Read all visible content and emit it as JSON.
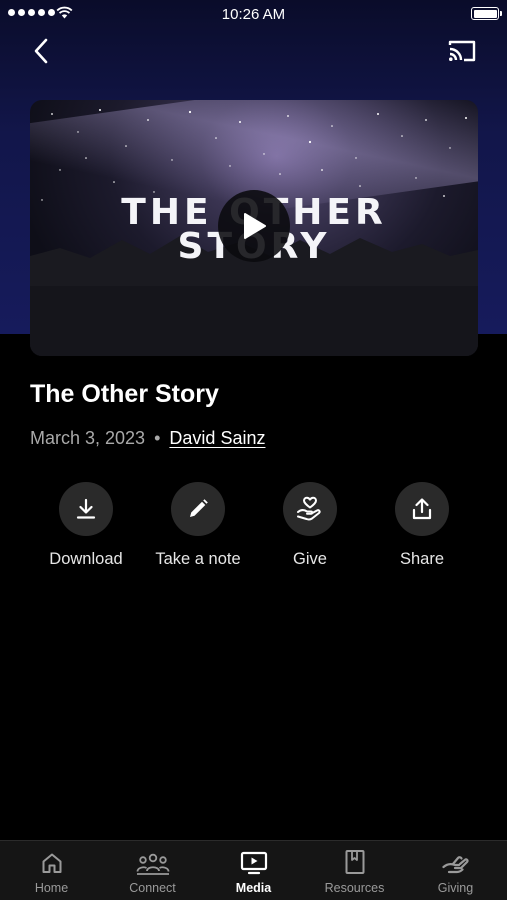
{
  "status_bar": {
    "time": "10:26 AM"
  },
  "video": {
    "title_line1": "THE OTHER",
    "title_line2": "STORY"
  },
  "sermon": {
    "title": "The Other Story",
    "date": "March 3, 2023",
    "separator": "•",
    "author": "David Sainz"
  },
  "actions": [
    {
      "label": "Download",
      "icon": "download-icon"
    },
    {
      "label": "Take a note",
      "icon": "pencil-icon"
    },
    {
      "label": "Give",
      "icon": "heart-hand-icon"
    },
    {
      "label": "Share",
      "icon": "share-icon"
    }
  ],
  "tabs": [
    {
      "label": "Home",
      "icon": "home-icon",
      "active": false
    },
    {
      "label": "Connect",
      "icon": "people-icon",
      "active": false
    },
    {
      "label": "Media",
      "icon": "tv-play-icon",
      "active": true
    },
    {
      "label": "Resources",
      "icon": "book-icon",
      "active": false
    },
    {
      "label": "Giving",
      "icon": "giving-hand-icon",
      "active": false
    }
  ],
  "colors": {
    "header_bg": "#161b5c",
    "background": "#000000",
    "tab_bar": "#151515",
    "action_circle": "#2a2a2a"
  }
}
